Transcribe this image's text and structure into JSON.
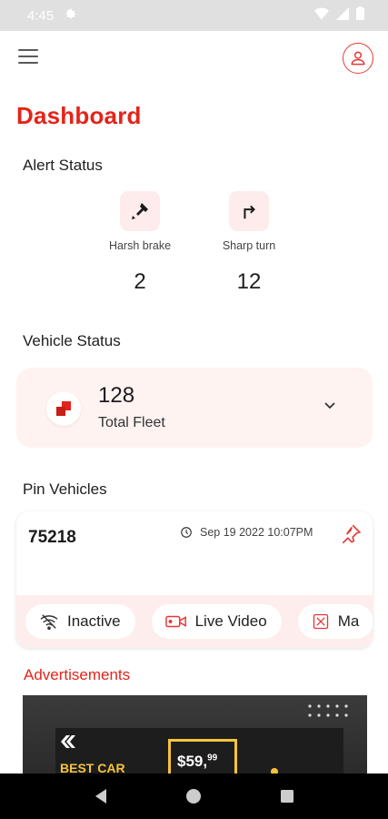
{
  "status_bar": {
    "time": "4:45"
  },
  "header": {
    "title": "Dashboard"
  },
  "alert_status": {
    "heading": "Alert Status",
    "items": [
      {
        "label": "Harsh brake",
        "count": "2",
        "icon": "harsh-brake-icon"
      },
      {
        "label": "Sharp turn",
        "count": "12",
        "icon": "sharp-turn-icon"
      }
    ]
  },
  "vehicle_status": {
    "heading": "Vehicle Status",
    "count": "128",
    "label": "Total Fleet"
  },
  "pin_vehicles": {
    "heading": "Pin Vehicles",
    "vehicle_id": "75218",
    "timestamp": "Sep 19 2022 10:07PM",
    "chips": [
      {
        "label": "Inactive",
        "icon": "wifi-off-icon"
      },
      {
        "label": "Live Video",
        "icon": "video-camera-icon"
      },
      {
        "label": "Ma",
        "icon": "map-icon"
      }
    ]
  },
  "advertisements": {
    "heading": "Advertisements",
    "banner": {
      "headline": "BEST CAR",
      "price": "$59,",
      "price_cents": "99"
    }
  },
  "colors": {
    "accent": "#e4241a",
    "card_bg": "#fff3f2",
    "chip_row_bg": "#fdeeed"
  }
}
